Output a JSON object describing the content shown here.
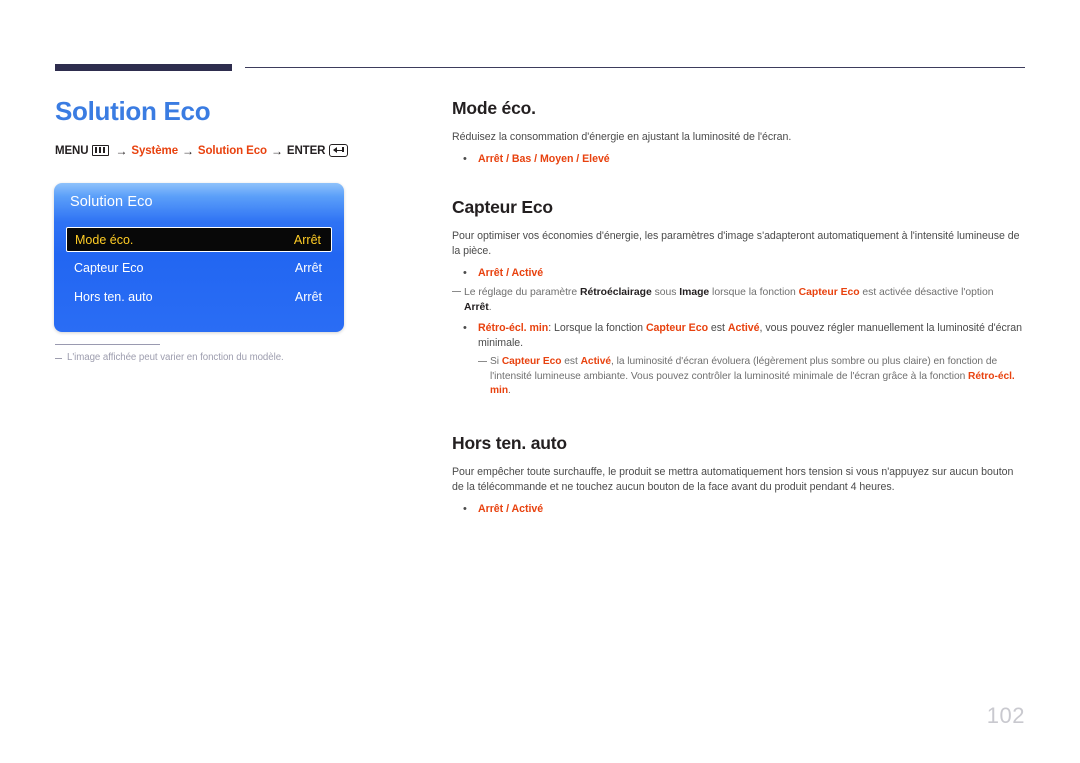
{
  "page": {
    "number": "102"
  },
  "left": {
    "title": "Solution Eco",
    "menu_path": {
      "menu_label": "MENU",
      "menu_icon": "menu-bars-icon",
      "arrow": "→",
      "step1": "Système",
      "step2": "Solution Eco",
      "enter_label": "ENTER",
      "enter_icon": "enter-return-icon"
    },
    "osd": {
      "title": "Solution Eco",
      "rows": [
        {
          "label": "Mode éco.",
          "value": "Arrêt",
          "selected": true
        },
        {
          "label": "Capteur Eco",
          "value": "Arrêt",
          "selected": false
        },
        {
          "label": "Hors ten. auto",
          "value": "Arrêt",
          "selected": false
        }
      ]
    },
    "osd_note": "L'image affichée peut varier en fonction du modèle."
  },
  "right": {
    "sections": [
      {
        "heading": "Mode éco.",
        "paragraph": "Réduisez la consommation d'énergie en ajustant la luminosité de l'écran.",
        "bullet_options": "Arrêt / Bas / Moyen / Elevé"
      },
      {
        "heading": "Capteur Eco",
        "paragraph": "Pour optimiser vos économies d'énergie, les paramètres d'image s'adapteront automatiquement à l'intensité lumineuse de la pièce.",
        "bullet_options": "Arrêt / Activé",
        "note": {
          "t1": "Le réglage du paramètre ",
          "b1": "Rétroéclairage",
          "t2": " sous ",
          "b2": "Image",
          "t3": " lorsque la fonction ",
          "o1": "Capteur Eco",
          "t4": " est activée désactive l'option ",
          "b3": "Arrêt",
          "t5": "."
        },
        "note_bullet": {
          "o1": "Rétro-écl. min",
          "t1": ": Lorsque la fonction ",
          "o2": "Capteur Eco",
          "t2": " est ",
          "o3": "Activé",
          "t3": ", vous pouvez régler manuellement la luminosité d'écran minimale."
        },
        "subnote": {
          "t1": "Si ",
          "o1": "Capteur Eco",
          "t2": " est ",
          "o2": "Activé",
          "t3": ", la luminosité d'écran évoluera (légèrement plus sombre ou plus claire) en fonction de l'intensité lumineuse ambiante. Vous pouvez contrôler la luminosité minimale de l'écran grâce à la fonction ",
          "o3": "Rétro-écl. min",
          "t4": "."
        }
      },
      {
        "heading": "Hors ten. auto",
        "paragraph": "Pour empêcher toute surchauffe, le produit se mettra automatiquement hors tension si vous n'appuyez sur aucun bouton de la télécommande et ne touchez aucun bouton de la face avant du produit pendant 4 heures.",
        "bullet_options": "Arrêt / Activé"
      }
    ]
  }
}
